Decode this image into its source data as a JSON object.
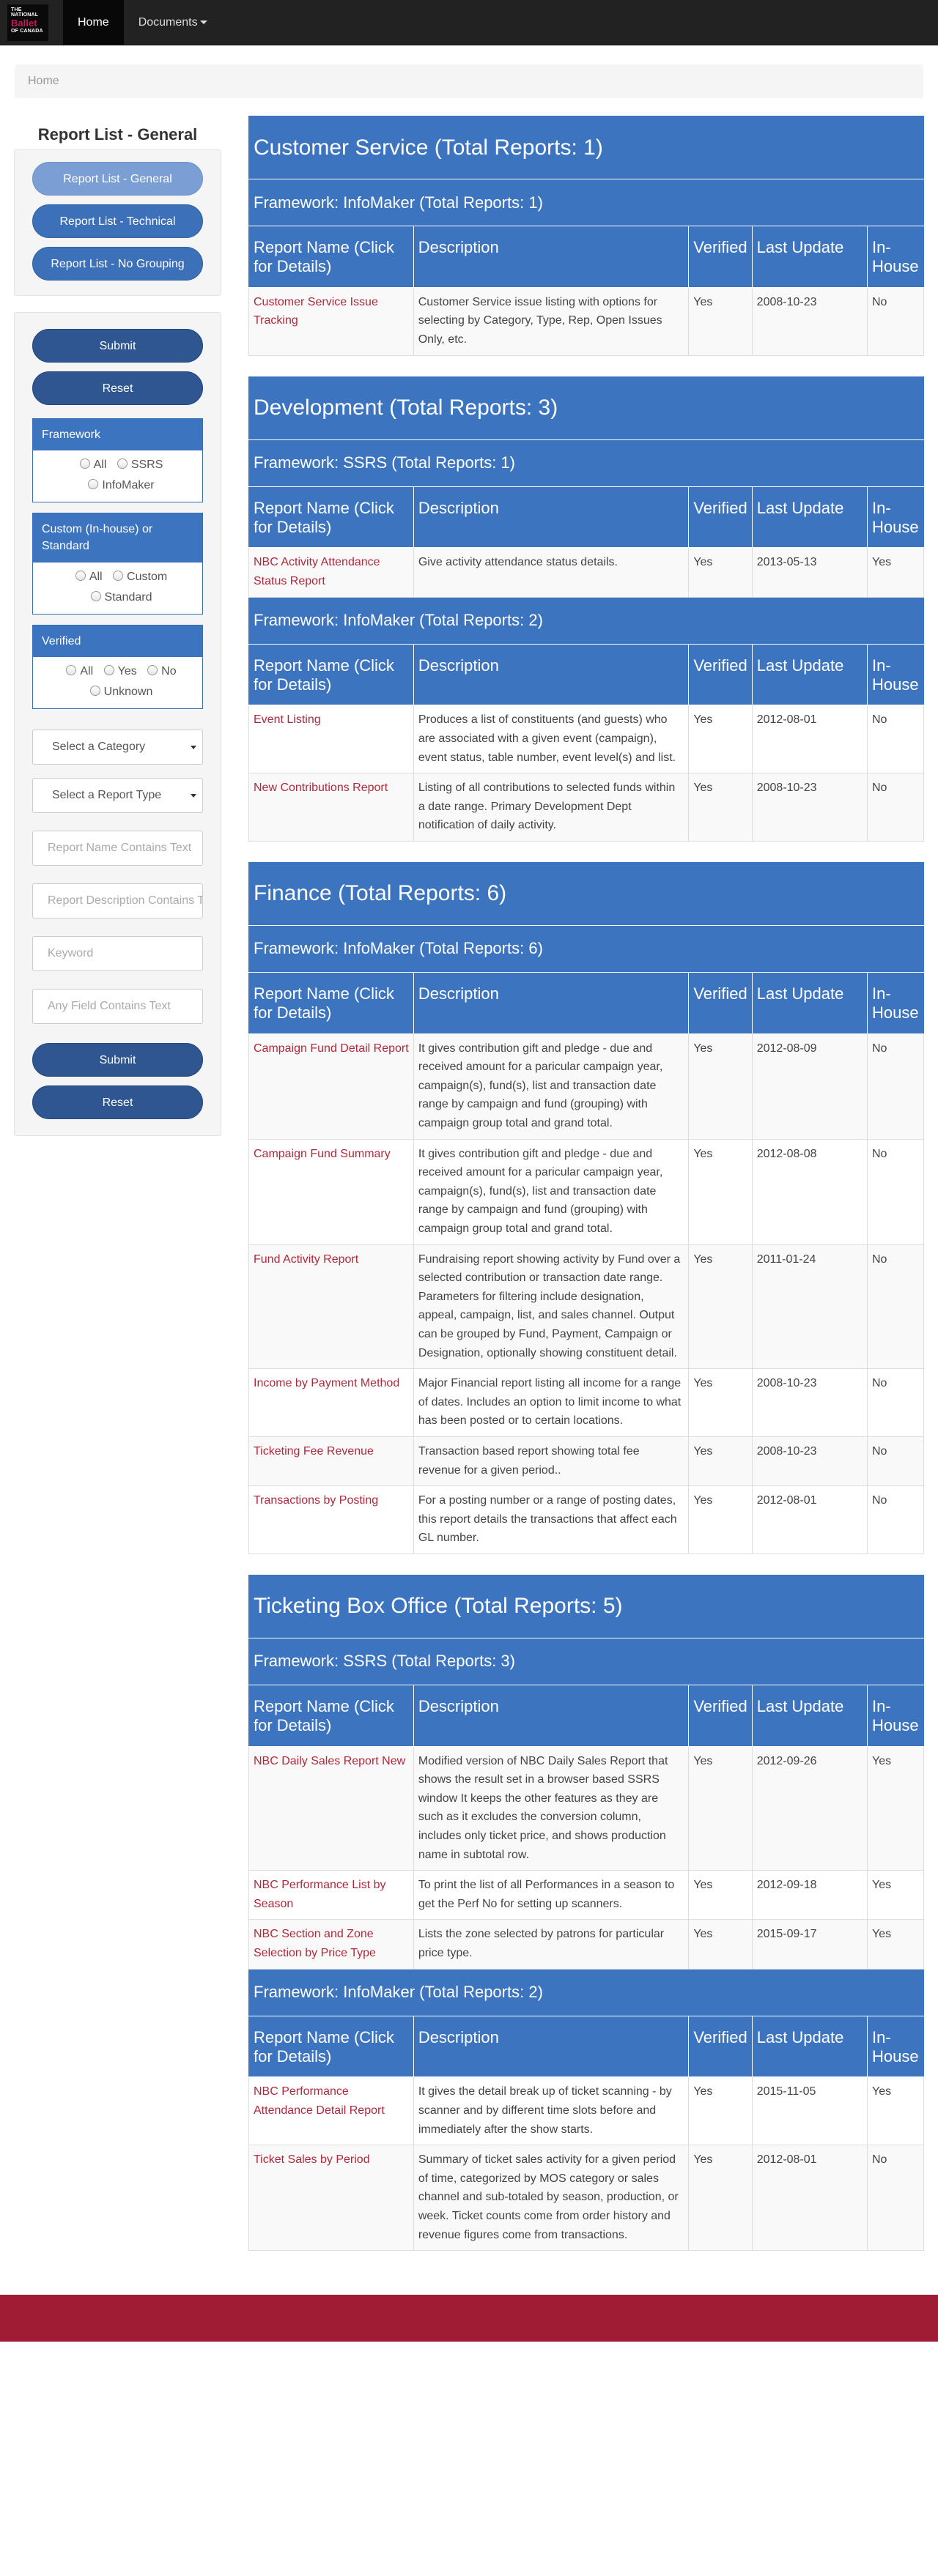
{
  "nav": {
    "logo": {
      "line1": "THE",
      "line2": "NATIONAL",
      "line3": "Ballet",
      "line4": "OF CANADA"
    },
    "home": "Home",
    "documents": "Documents"
  },
  "breadcrumb": {
    "home": "Home"
  },
  "sidebar": {
    "title": "Report List - General",
    "list_buttons": [
      "Report List - General",
      "Report List - Technical",
      "Report List - No Grouping"
    ],
    "submit": "Submit",
    "reset": "Reset",
    "framework": {
      "title": "Framework",
      "options": [
        "All",
        "SSRS",
        "InfoMaker"
      ]
    },
    "custom": {
      "title": "Custom (In-house) or Standard",
      "options": [
        "All",
        "Custom",
        "Standard"
      ]
    },
    "verified": {
      "title": "Verified",
      "options": [
        "All",
        "Yes",
        "No",
        "Unknown"
      ]
    },
    "category_select": "Select a Category",
    "report_type_select": "Select a Report Type",
    "placeholders": {
      "report_name": "Report Name Contains Text",
      "report_description": "Report Description Contains Text",
      "keyword": "Keyword",
      "any_field": "Any Field Contains Text"
    }
  },
  "table_headers": [
    "Report Name (Click for Details)",
    "Description",
    "Verified",
    "Last Update",
    "In-House"
  ],
  "sections": [
    {
      "title": "Customer Service (Total Reports: 1)",
      "frameworks": [
        {
          "title": "Framework: InfoMaker (Total Reports: 1)",
          "rows": [
            {
              "name": "Customer Service Issue Tracking",
              "desc": "Customer Service issue listing with options for selecting by Category, Type, Rep, Open Issues Only, etc.",
              "verified": "Yes",
              "updated": "2008-10-23",
              "inhouse": "No"
            }
          ]
        }
      ]
    },
    {
      "title": "Development (Total Reports: 3)",
      "frameworks": [
        {
          "title": "Framework: SSRS (Total Reports: 1)",
          "rows": [
            {
              "name": "NBC Activity Attendance Status Report",
              "desc": "Give activity attendance status details.",
              "verified": "Yes",
              "updated": "2013-05-13",
              "inhouse": "Yes"
            }
          ]
        },
        {
          "title": "Framework: InfoMaker (Total Reports: 2)",
          "rows": [
            {
              "name": "Event Listing",
              "desc": "Produces a list of constituents (and guests) who are associated with a given event (campaign), event status, table number, event level(s) and list.",
              "verified": "Yes",
              "updated": "2012-08-01",
              "inhouse": "No"
            },
            {
              "name": "New Contributions Report",
              "desc": "Listing of all contributions to selected funds within a date range. Primary Development Dept notification of daily activity.",
              "verified": "Yes",
              "updated": "2008-10-23",
              "inhouse": "No"
            }
          ]
        }
      ]
    },
    {
      "title": "Finance (Total Reports: 6)",
      "frameworks": [
        {
          "title": "Framework: InfoMaker (Total Reports: 6)",
          "rows": [
            {
              "name": "Campaign Fund Detail Report",
              "desc": "It gives contribution gift and pledge - due and received amount for a paricular campaign year, campaign(s), fund(s), list and transaction date range by campaign and fund (grouping) with campaign group total and grand total.",
              "verified": "Yes",
              "updated": "2012-08-09",
              "inhouse": "No"
            },
            {
              "name": "Campaign Fund Summary",
              "desc": "It gives contribution gift and pledge - due and received amount for a paricular campaign year, campaign(s), fund(s), list and transaction date range by campaign and fund (grouping) with campaign group total and grand total.",
              "verified": "Yes",
              "updated": "2012-08-08",
              "inhouse": "No"
            },
            {
              "name": "Fund Activity Report",
              "desc": "Fundraising report showing activity by Fund over a selected contribution or transaction date range. Parameters for filtering include designation, appeal, campaign, list, and sales channel. Output can be grouped by Fund, Payment, Campaign or Designation, optionally showing constituent detail.",
              "verified": "Yes",
              "updated": "2011-01-24",
              "inhouse": "No"
            },
            {
              "name": "Income by Payment Method",
              "desc": "Major Financial report listing all income for a range of dates. Includes an option to limit income to what has been posted or to certain locations.",
              "verified": "Yes",
              "updated": "2008-10-23",
              "inhouse": "No"
            },
            {
              "name": "Ticketing Fee Revenue",
              "desc": "Transaction based report showing total fee revenue for a given period..",
              "verified": "Yes",
              "updated": "2008-10-23",
              "inhouse": "No"
            },
            {
              "name": "Transactions by Posting",
              "desc": "For a posting number or a range of posting dates, this report details the transactions that affect each GL number.",
              "verified": "Yes",
              "updated": "2012-08-01",
              "inhouse": "No"
            }
          ]
        }
      ]
    },
    {
      "title": "Ticketing Box Office (Total Reports: 5)",
      "frameworks": [
        {
          "title": "Framework: SSRS (Total Reports: 3)",
          "rows": [
            {
              "name": "NBC Daily Sales Report New",
              "desc": "Modified version of NBC Daily Sales Report that shows the result set in a browser based SSRS window It keeps the other features as they are such as it excludes the conversion column, includes only ticket price, and shows production name in subtotal row.",
              "verified": "Yes",
              "updated": "2012-09-26",
              "inhouse": "Yes"
            },
            {
              "name": "NBC Performance List by Season",
              "desc": "To print the list of all Performances in a season to get the Perf No for setting up scanners.",
              "verified": "Yes",
              "updated": "2012-09-18",
              "inhouse": "Yes"
            },
            {
              "name": "NBC Section and Zone Selection by Price Type",
              "desc": "Lists the zone selected by patrons for particular price type.",
              "verified": "Yes",
              "updated": "2015-09-17",
              "inhouse": "Yes"
            }
          ]
        },
        {
          "title": "Framework: InfoMaker (Total Reports: 2)",
          "rows": [
            {
              "name": "NBC Performance Attendance Detail Report",
              "desc": "It gives the detail break up of ticket scanning - by scanner and by different time slots before and immediately after the show starts.",
              "verified": "Yes",
              "updated": "2015-11-05",
              "inhouse": "Yes"
            },
            {
              "name": "Ticket Sales by Period",
              "desc": "Summary of ticket sales activity for a given period of time, categorized by MOS category or sales channel and sub-totaled by season, production, or week. Ticket counts come from order history and revenue figures come from transactions.",
              "verified": "Yes",
              "updated": "2012-08-01",
              "inhouse": "No"
            }
          ]
        }
      ]
    }
  ]
}
